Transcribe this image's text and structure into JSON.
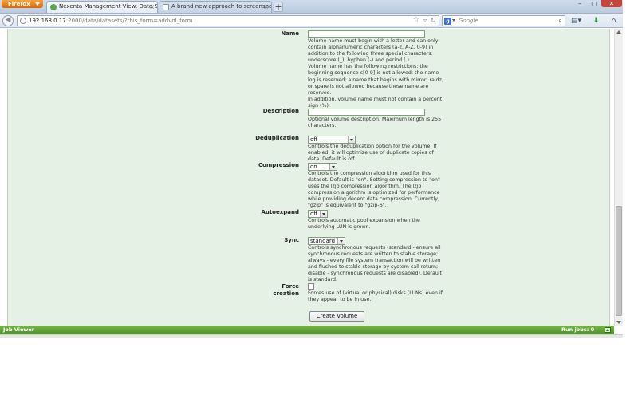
{
  "browser": {
    "menu_button": "Firefox",
    "tabs": [
      {
        "label": "Nexenta Management View: Data Sets",
        "close": "×"
      },
      {
        "label": "A brand new approach to screenshot ...",
        "close": "×"
      }
    ],
    "new_tab": "+",
    "url_host": "192.168.0.17",
    "url_rest": ":2000/data/datasets/?this_form=addvol_form",
    "search_placeholder": "Google",
    "search_engine_letter": "g"
  },
  "form": {
    "name": {
      "label": "Name",
      "value": "",
      "help": "Volume name must begin with a letter and can only contain alphanumeric characters (a-z, A-Z, 0-9) in addition to the following three special characters: underscore (_), hyphen (-) and period (.)\nVolume name has the following restrictions: the beginning sequence c[0-9] is not allowed; the name log is reserved; a name that begins with mirror, raidz, or spare is not allowed because these name are reserved.\nIn addition, volume name must not contain a percent sign (%)."
    },
    "description": {
      "label": "Description",
      "value": "",
      "help": "Optional volume description. Maximum length is 255 characters."
    },
    "deduplication": {
      "label": "Deduplication",
      "selected": "off",
      "help": "Controls the deduplication option for the volume. If enabled, it will optimize use of duplicate copies of data. Default is off."
    },
    "compression": {
      "label": "Compression",
      "selected": "on",
      "help": "Controls the compression algorithm used for this dataset. Default is \"on\". Setting compression to \"on\" uses the lzjb compression algorithm. The lzjb compression algorithm is optimized for performance while providing decent data compression. Currently, \"gzip\" is equivalent to \"gzip-6\"."
    },
    "autoexpand": {
      "label": "Autoexpand",
      "selected": "off",
      "help": "Controls automatic pool expansion when the underlying LUN is grown."
    },
    "sync": {
      "label": "Sync",
      "selected": "standard",
      "help": "Controls synchronous requests (standard - ensure all synchronous requests are written to stable storage; always - every file system transaction will be written and flushed to stable storage by system call return; disable - synchronous requests are disabled). Default is standard."
    },
    "force_creation": {
      "label": "Force creation",
      "checked": false,
      "help": "Forces use of (virtual or physical) disks (LUNs) even if they appear to be in use."
    },
    "submit_label": "Create Volume"
  },
  "job_viewer": {
    "title": "Job Viewer",
    "run_jobs": "Run jobs: 0"
  },
  "colors": {
    "panel_bg": "#e5f1e4",
    "job_bar": "#5f9f37",
    "firefox_button": "#e8801f"
  }
}
